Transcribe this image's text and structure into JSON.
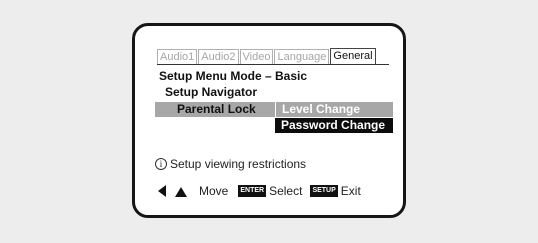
{
  "tabs": [
    "Audio1",
    "Audio2",
    "Video",
    "Language",
    "General"
  ],
  "active_tab": "General",
  "menu": {
    "mode_line": "Setup Menu Mode – Basic",
    "navigator": "Setup Navigator",
    "parental_lock": "Parental Lock"
  },
  "submenu": {
    "level_change": "Level Change",
    "password_change": "Password Change"
  },
  "info": {
    "icon_glyph": "i",
    "text": "Setup viewing restrictions"
  },
  "footer": {
    "move_label": "Move",
    "enter_key": "ENTER",
    "select_label": "Select",
    "setup_key": "SETUP",
    "exit_label": "Exit"
  },
  "icons": [
    "left-arrow-icon",
    "up-arrow-icon",
    "info-icon"
  ]
}
